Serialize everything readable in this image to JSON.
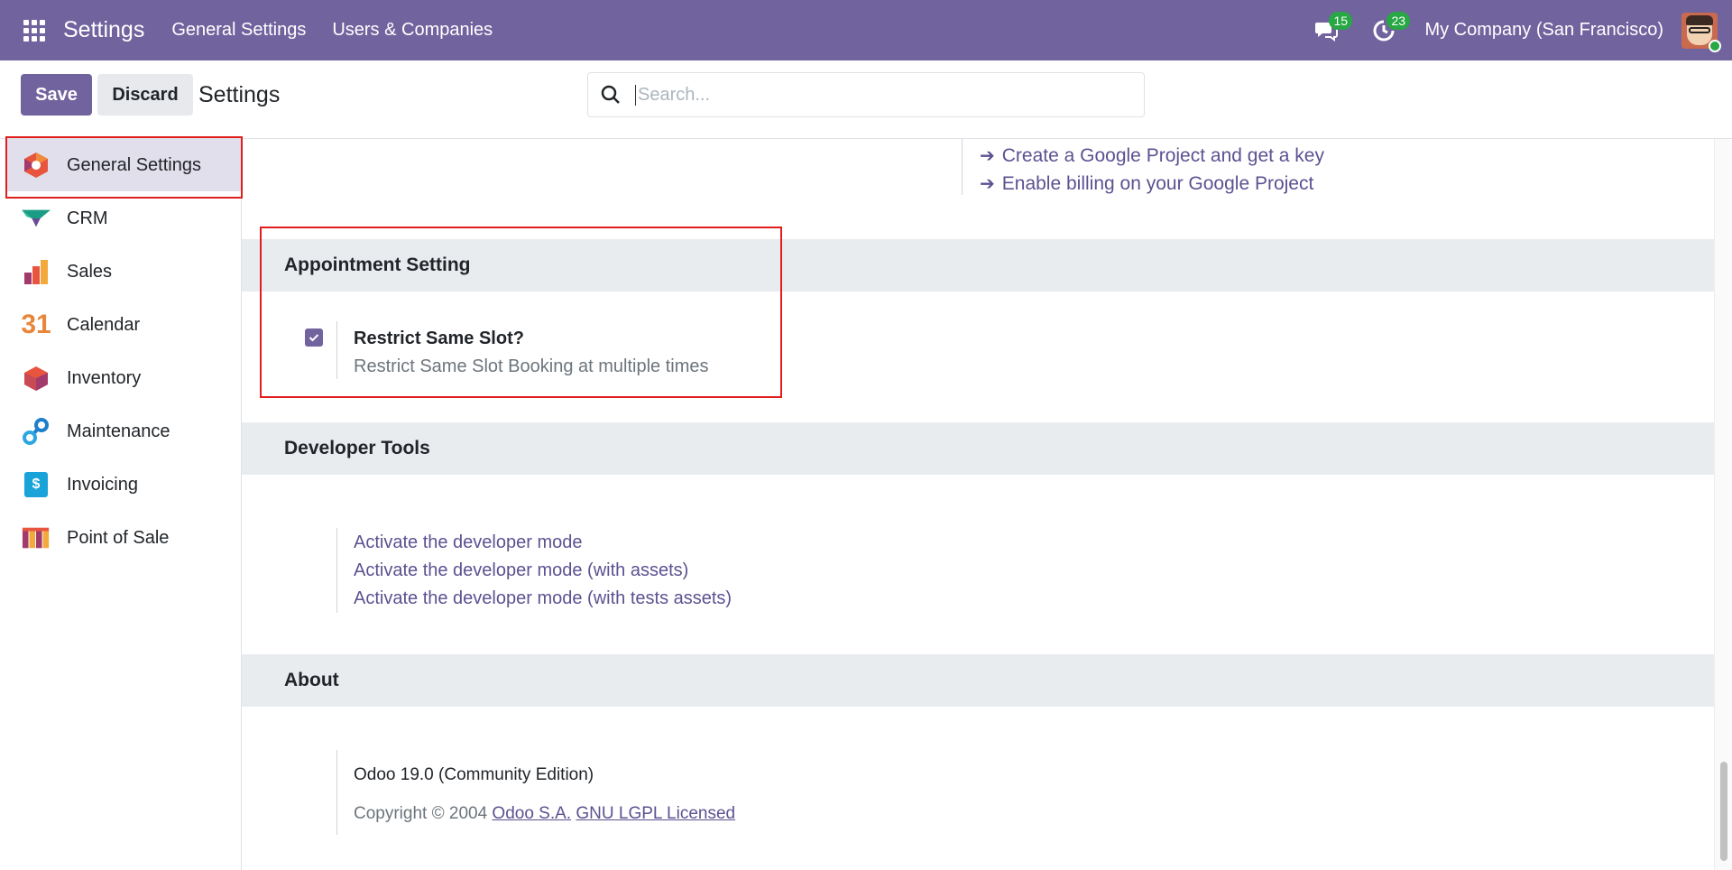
{
  "navbar": {
    "brand": "Settings",
    "menus": [
      "General Settings",
      "Users & Companies"
    ],
    "messages_count": "15",
    "activities_count": "23",
    "company": "My Company (San Francisco)"
  },
  "control_panel": {
    "save_label": "Save",
    "discard_label": "Discard",
    "title": "Settings",
    "search_placeholder": "Search..."
  },
  "sidebar": {
    "items": [
      {
        "label": "General Settings",
        "icon": "general-settings-icon"
      },
      {
        "label": "CRM",
        "icon": "crm-icon"
      },
      {
        "label": "Sales",
        "icon": "sales-icon"
      },
      {
        "label": "Calendar",
        "icon": "calendar-icon"
      },
      {
        "label": "Inventory",
        "icon": "inventory-icon"
      },
      {
        "label": "Maintenance",
        "icon": "maintenance-icon"
      },
      {
        "label": "Invoicing",
        "icon": "invoicing-icon"
      },
      {
        "label": "Point of Sale",
        "icon": "point-of-sale-icon"
      }
    ],
    "calendar_icon_text": "31",
    "invoicing_icon_text": "$"
  },
  "content": {
    "google_links": [
      "Create a Google Project and get a key",
      "Enable billing on your Google Project"
    ],
    "appointment": {
      "header": "Appointment Setting",
      "title": "Restrict Same Slot?",
      "description": "Restrict Same Slot Booking at multiple times",
      "checked": true
    },
    "developer": {
      "header": "Developer Tools",
      "links": [
        "Activate the developer mode",
        "Activate the developer mode (with assets)",
        "Activate the developer mode (with tests assets)"
      ]
    },
    "about": {
      "header": "About",
      "version": "Odoo 19.0 (Community Edition)",
      "copyright_prefix": "Copyright © 2004",
      "company_link": "Odoo S.A.",
      "license_link": "GNU LGPL Licensed"
    }
  },
  "colors": {
    "brand": "#71639e",
    "link": "#5b5291",
    "badge": "#28a745",
    "highlight_border": "#e11d1d"
  }
}
